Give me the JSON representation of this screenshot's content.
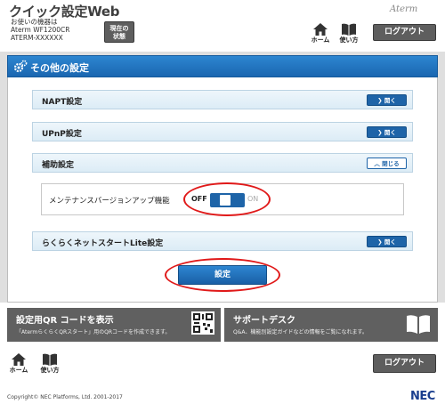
{
  "header": {
    "app_title": "クイック設定Web",
    "device_label": "お使いの機器は",
    "device_model": "Aterm WF1200CR",
    "device_ssid": "ATERM-XXXXXX",
    "status_line1": "現在の",
    "status_line2": "状態",
    "brand_logo": "Aterm",
    "home_label": "ホーム",
    "guide_label": "使い方",
    "logout_label": "ログアウト"
  },
  "page": {
    "title": "その他の設定"
  },
  "sections": [
    {
      "label": "NAPT設定",
      "button": "開く",
      "state": "collapsed"
    },
    {
      "label": "UPnP設定",
      "button": "開く",
      "state": "collapsed"
    },
    {
      "label": "補助設定",
      "button": "閉じる",
      "state": "expanded"
    },
    {
      "label": "らくらくネットスタートLite設定",
      "button": "開く",
      "state": "collapsed"
    }
  ],
  "maintenance": {
    "label": "メンテナンスバージョンアップ機能",
    "off_label": "OFF",
    "on_label": "ON",
    "value": "OFF"
  },
  "submit_label": "設定",
  "tiles": {
    "qr_title": "設定用QR コードを表示",
    "qr_desc": "「AtermらくらくQRスタート」用のQRコードを作成できます。",
    "support_title": "サポートデスク",
    "support_desc": "Q&A、機能別設定ガイドなどの情報をご覧になれます。"
  },
  "footer": {
    "home_label": "ホーム",
    "guide_label": "使い方",
    "logout_label": "ログアウト",
    "copyright": "Copyright© NEC Platforms, Ltd. 2001-2017",
    "company_logo": "NEC"
  },
  "colors": {
    "accent_blue": "#1e64a8",
    "highlight_red": "#e01919",
    "tile_gray": "#606060"
  }
}
